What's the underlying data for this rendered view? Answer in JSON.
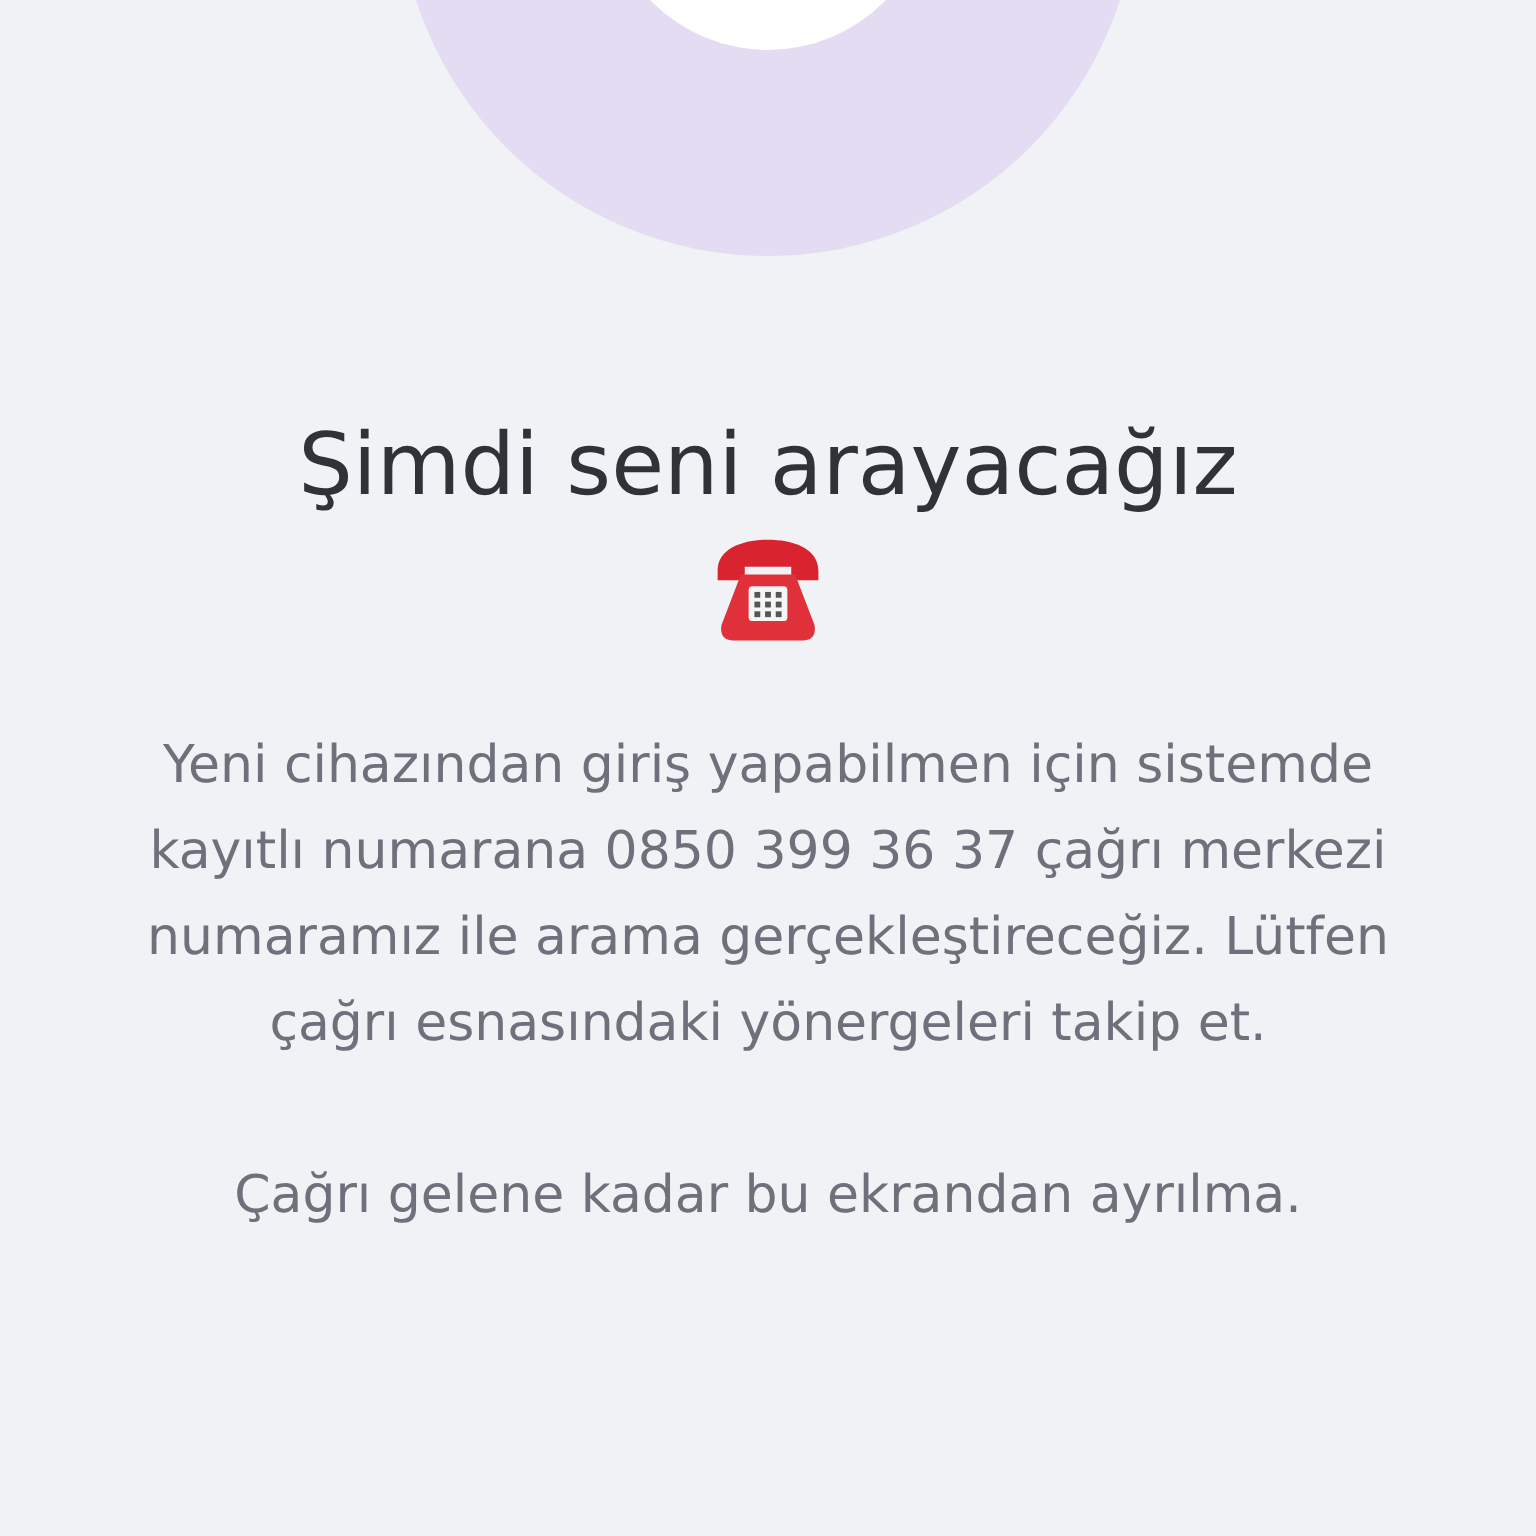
{
  "title": "Şimdi seni arayacağız",
  "message": "Yeni cihazından giriş yapabilmen için sistemde kayıtlı numarana 0850 399 36 37 çağrı merkezi numaramız ile arama gerçekleştireceğiz. Lütfen çağrı esnasındaki yönergeleri takip et.",
  "notice": "Çağrı gelene kadar bu ekrandan ayrılma."
}
